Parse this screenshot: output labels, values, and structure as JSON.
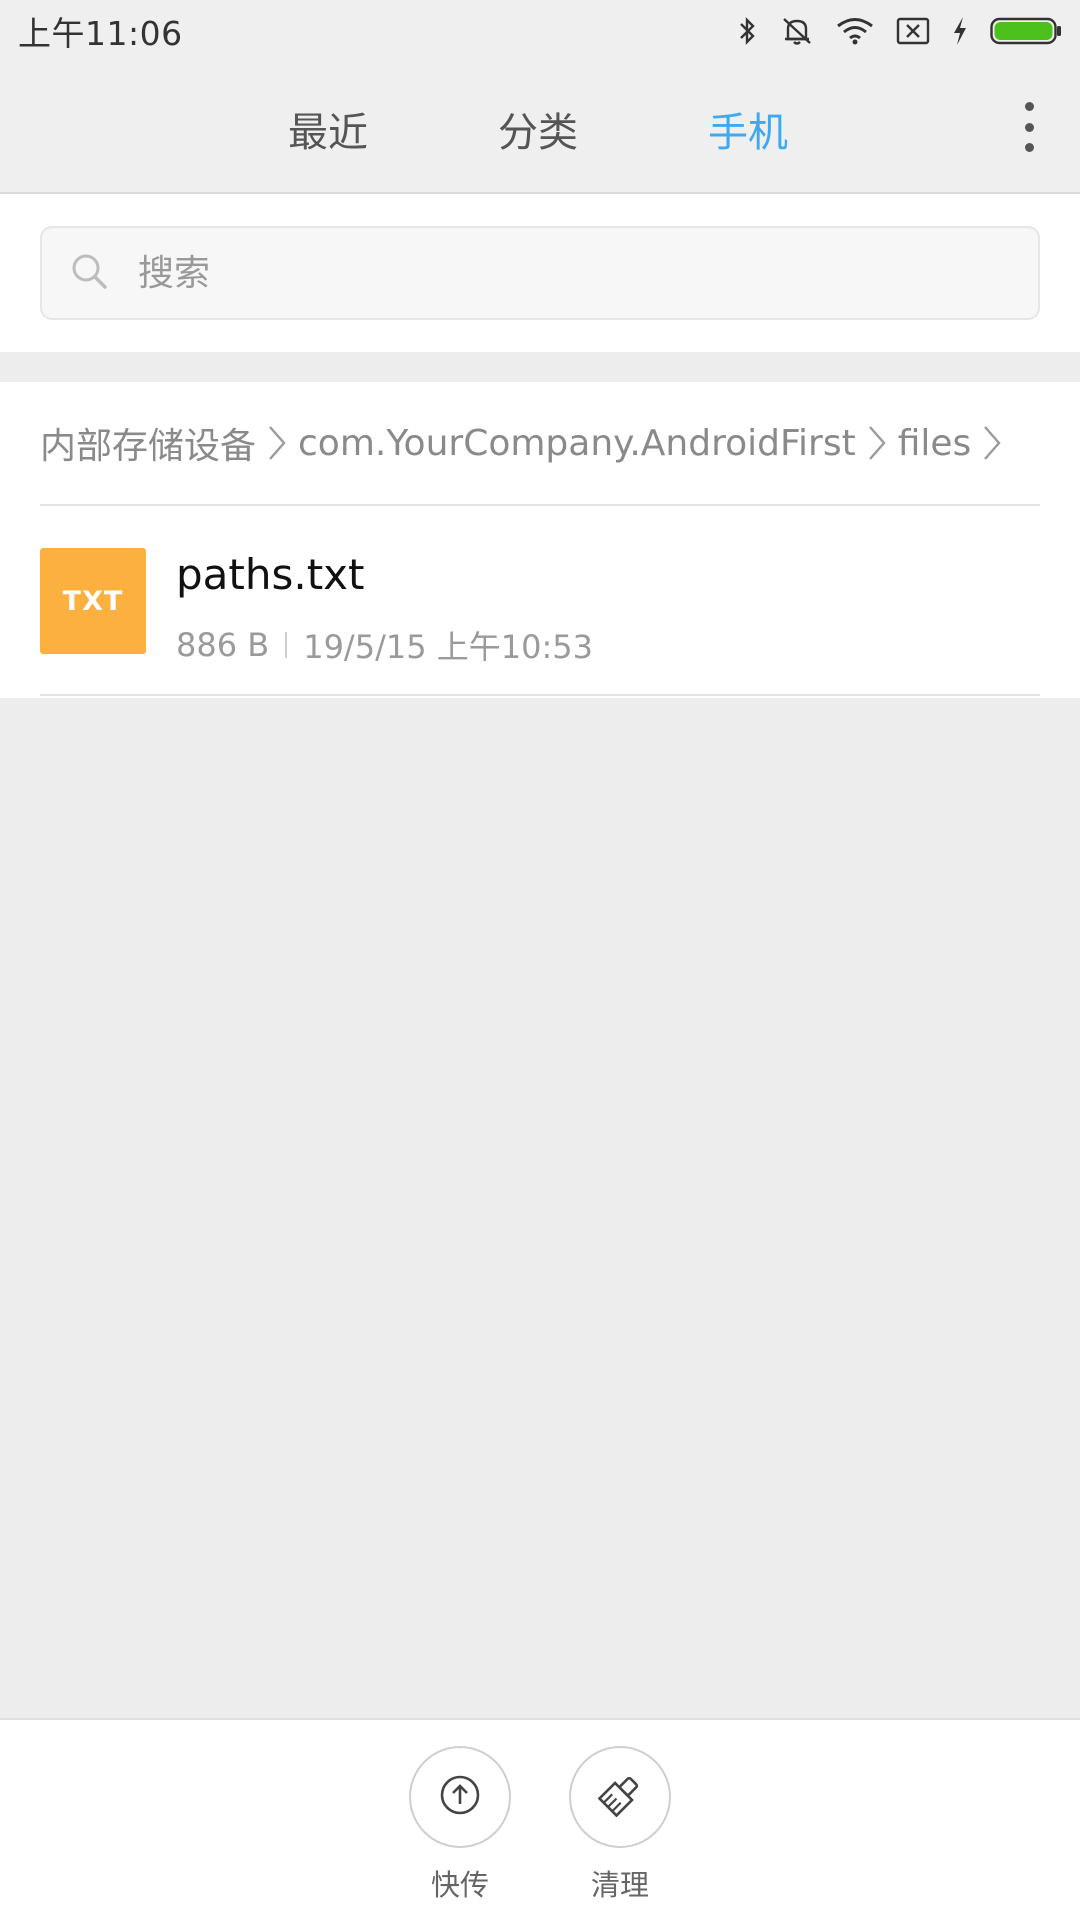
{
  "status_bar": {
    "time": "上午11:06",
    "icons": [
      "bluetooth-icon",
      "mute-icon",
      "wifi-icon",
      "sim-none-icon",
      "charging-icon",
      "battery-icon"
    ],
    "battery_color": "#4cc11b"
  },
  "tabs": [
    {
      "label": "最近",
      "active": false
    },
    {
      "label": "分类",
      "active": false
    },
    {
      "label": "手机",
      "active": true
    }
  ],
  "colors": {
    "accent": "#3ea8f2",
    "txt_icon": "#fbb03f"
  },
  "search": {
    "placeholder": "搜索"
  },
  "breadcrumb": {
    "items": [
      "内部存储设备",
      "com.YourCompany.AndroidFirst",
      "files"
    ]
  },
  "files": [
    {
      "type_label": "TXT",
      "name": "paths.txt",
      "size": "886 B",
      "modified": "19/5/15 上午10:53"
    }
  ],
  "bottom_actions": [
    {
      "label": "快传",
      "icon": "upload-icon"
    },
    {
      "label": "清理",
      "icon": "broom-icon"
    }
  ]
}
